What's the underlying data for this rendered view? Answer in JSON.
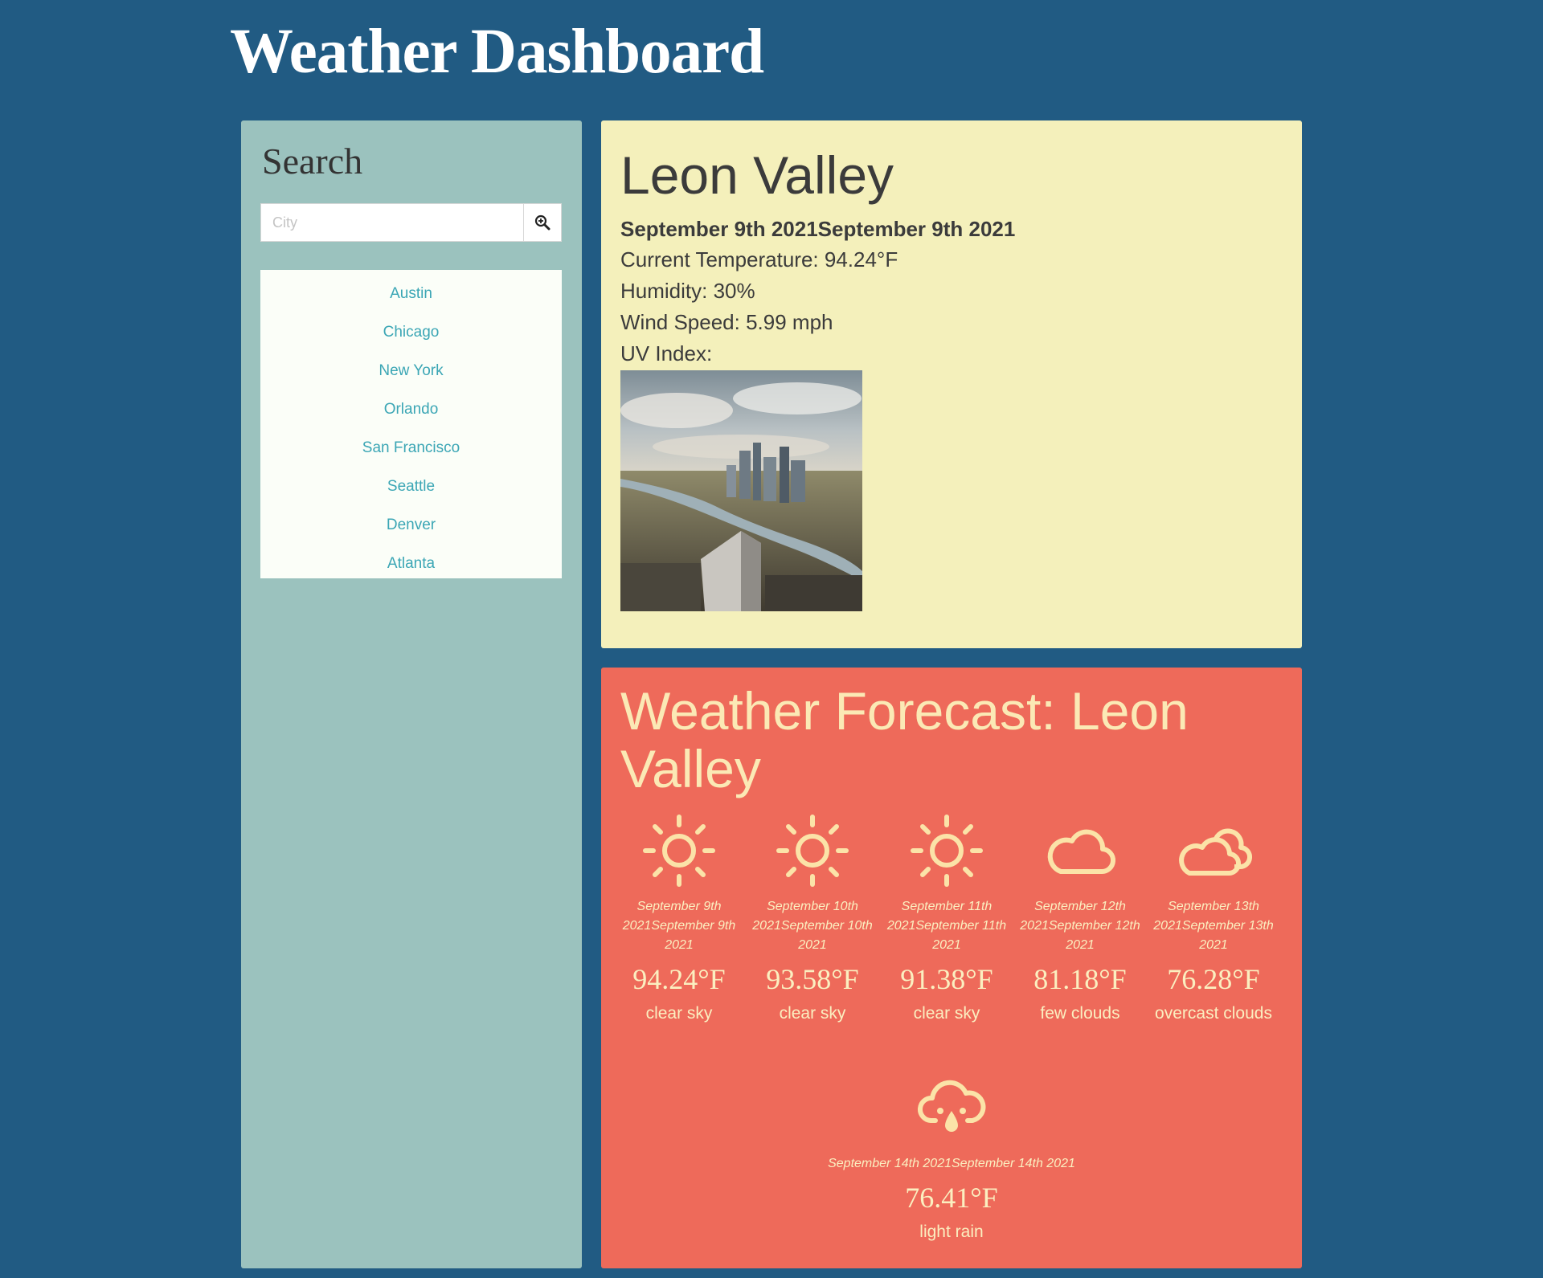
{
  "app": {
    "title": "Weather Dashboard"
  },
  "search": {
    "heading": "Search",
    "placeholder": "City",
    "value": "",
    "button_icon": "search-icon",
    "cities": [
      "Austin",
      "Chicago",
      "New York",
      "Orlando",
      "San Francisco",
      "Seattle",
      "Denver",
      "Atlanta"
    ]
  },
  "current": {
    "city": "Leon Valley",
    "date": "September 9th 2021September 9th 2021",
    "temperature": "Current Temperature: 94.24°F",
    "humidity": "Humidity: 30%",
    "wind": "Wind Speed: 5.99 mph",
    "uv": "UV Index:"
  },
  "forecast": {
    "title": "Weather Forecast: Leon Valley",
    "days": [
      {
        "icon": "sun-icon",
        "date": "September 9th 2021September 9th 2021",
        "temp": "94.24°F",
        "desc": "clear sky"
      },
      {
        "icon": "sun-icon",
        "date": "September 10th 2021September 10th 2021",
        "temp": "93.58°F",
        "desc": "clear sky"
      },
      {
        "icon": "sun-icon",
        "date": "September 11th 2021September 11th 2021",
        "temp": "91.38°F",
        "desc": "clear sky"
      },
      {
        "icon": "cloud-icon",
        "date": "September 12th 2021September 12th 2021",
        "temp": "81.18°F",
        "desc": "few clouds"
      },
      {
        "icon": "clouds-icon",
        "date": "September 13th 2021September 13th 2021",
        "temp": "76.28°F",
        "desc": "overcast clouds"
      },
      {
        "icon": "rain-cloud-icon",
        "date": "September 14th 2021September 14th 2021",
        "temp": "76.41°F",
        "desc": "light rain"
      }
    ]
  },
  "colors": {
    "page_bg": "#215b83",
    "sidebar_bg": "#9bc2be",
    "current_bg": "#f4f0bb",
    "forecast_bg": "#ee6a5a",
    "link": "#3ba6b5",
    "forecast_text": "#fbefc0"
  }
}
